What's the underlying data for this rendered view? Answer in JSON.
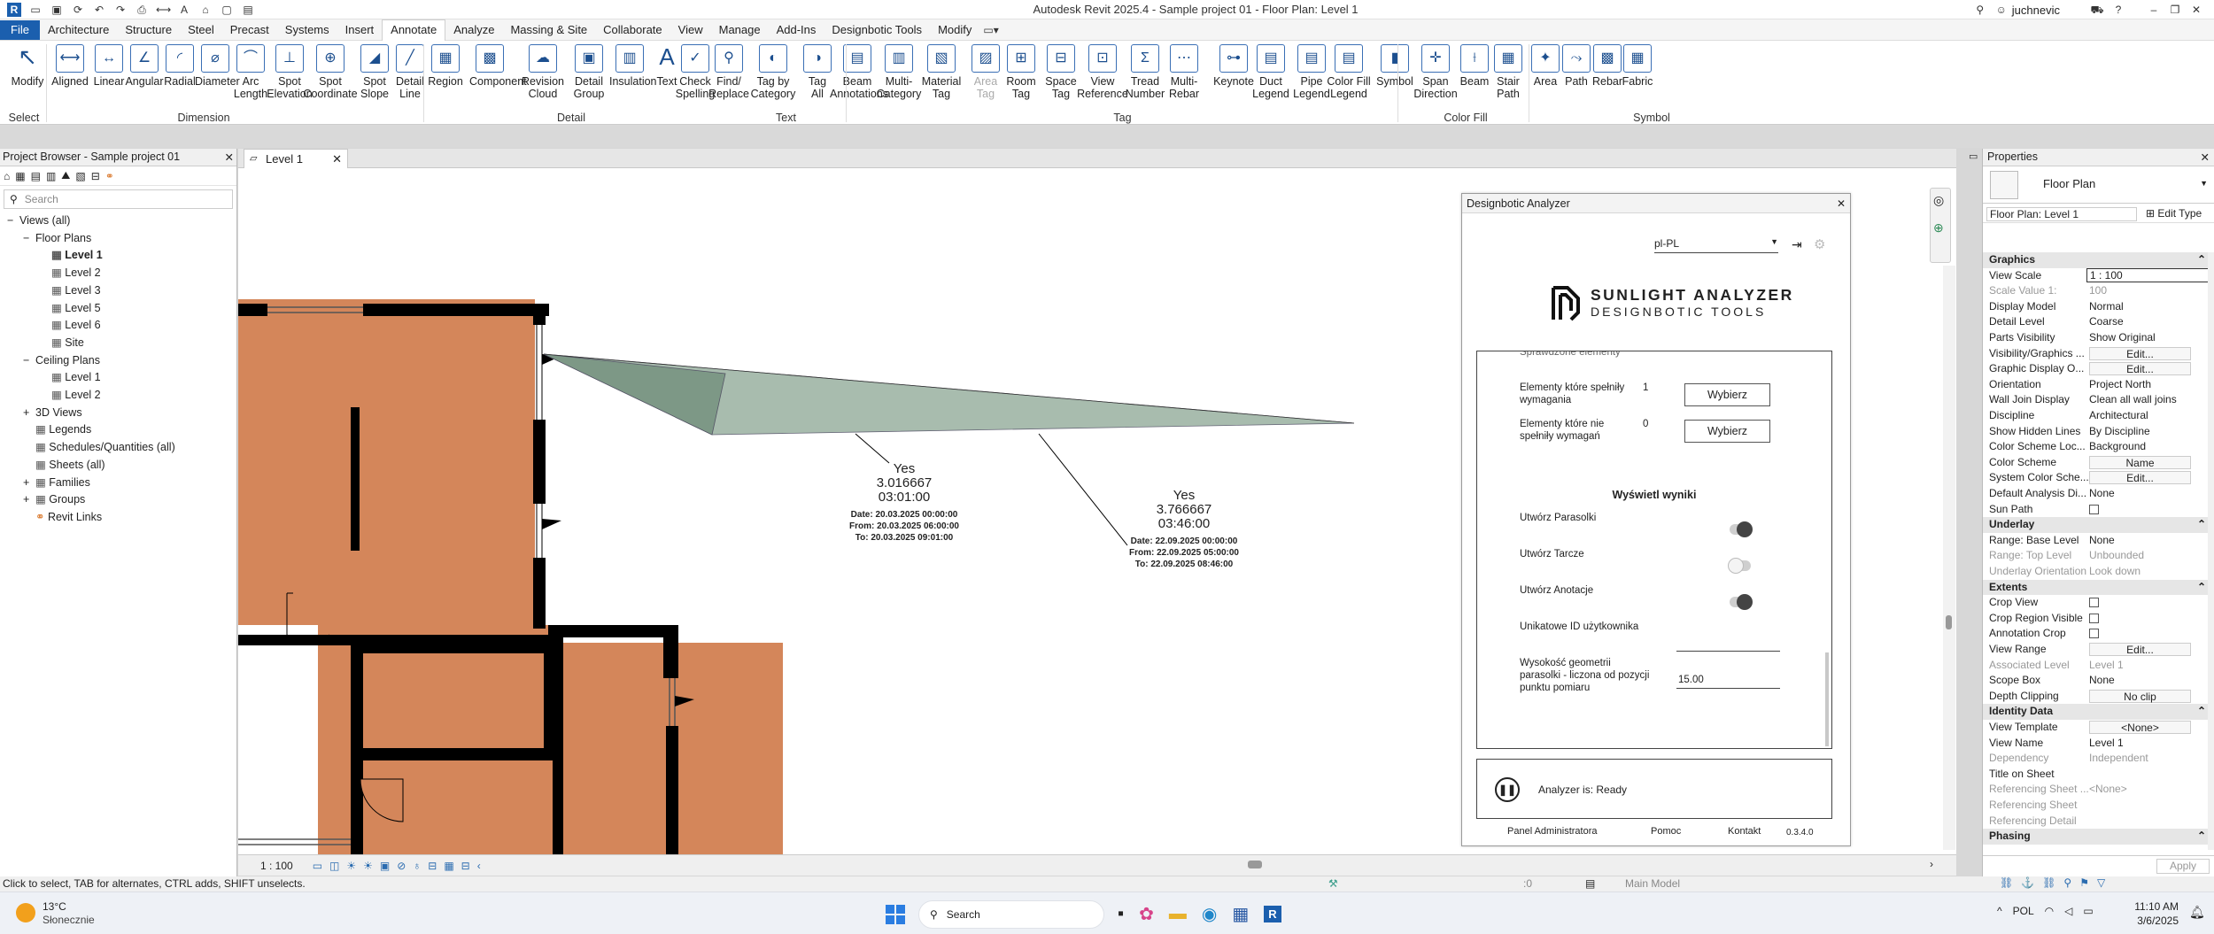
{
  "app": {
    "title": "Autodesk Revit 2025.4 - Sample project 01 - Floor Plan: Level 1",
    "user": "juchnevic"
  },
  "menu": [
    "File",
    "Architecture",
    "Structure",
    "Steel",
    "Precast",
    "Systems",
    "Insert",
    "Annotate",
    "Analyze",
    "Massing & Site",
    "Collaborate",
    "View",
    "Manage",
    "Add-Ins",
    "Designbotic Tools",
    "Modify"
  ],
  "ribbon": {
    "buttons": [
      {
        "label": "Modify"
      },
      {
        "label": "Aligned"
      },
      {
        "label": "Linear"
      },
      {
        "label": "Angular"
      },
      {
        "label": "Radial"
      },
      {
        "label": "Diameter"
      },
      {
        "label": "Arc\nLength"
      },
      {
        "label": "Spot\nElevation"
      },
      {
        "label": "Spot\nCoordinate"
      },
      {
        "label": "Spot\nSlope"
      },
      {
        "label": "Detail\nLine"
      },
      {
        "label": "Region"
      },
      {
        "label": "Component"
      },
      {
        "label": "Revision\nCloud"
      },
      {
        "label": "Detail\nGroup"
      },
      {
        "label": "Insulation"
      },
      {
        "label": "Text"
      },
      {
        "label": "Check\nSpelling"
      },
      {
        "label": "Find/\nReplace"
      },
      {
        "label": "Tag by\nCategory"
      },
      {
        "label": "Tag\nAll"
      },
      {
        "label": "Beam\nAnnotations"
      },
      {
        "label": "Multi-\nCategory"
      },
      {
        "label": "Material\nTag"
      },
      {
        "label": "Area\nTag"
      },
      {
        "label": "Room\nTag"
      },
      {
        "label": "Space\nTag"
      },
      {
        "label": "View\nReference"
      },
      {
        "label": "Tread\nNumber"
      },
      {
        "label": "Multi-\nRebar"
      },
      {
        "label": "Keynote"
      },
      {
        "label": "Duct\nLegend"
      },
      {
        "label": "Pipe\nLegend"
      },
      {
        "label": "Color Fill\nLegend"
      },
      {
        "label": "Symbol"
      },
      {
        "label": "Span\nDirection"
      },
      {
        "label": "Beam"
      },
      {
        "label": "Stair\nPath"
      },
      {
        "label": "Area"
      },
      {
        "label": "Path"
      },
      {
        "label": "Rebar"
      },
      {
        "label": "Fabric"
      }
    ],
    "groups": [
      "Select",
      "Dimension",
      "Detail",
      "Text",
      "Tag",
      "Color Fill",
      "Symbol"
    ]
  },
  "browser": {
    "title": "Project Browser - Sample project 01",
    "search_placeholder": "Search",
    "tree": [
      "Views (all)",
      "Floor Plans",
      "Level 1",
      "Level 2",
      "Level 3",
      "Level 5",
      "Level 6",
      "Site",
      "Ceiling Plans",
      "Level 1",
      "Level 2",
      "3D Views",
      "Legends",
      "Schedules/Quantities (all)",
      "Sheets (all)",
      "Families",
      "Groups",
      "Revit Links"
    ]
  },
  "view": {
    "tab": "Level 1",
    "scale": "1 : 100",
    "annotations": [
      {
        "yes": "Yes",
        "value": "3.016667",
        "time": "03:01:00",
        "date": "Date: 20.03.2025 00:00:00",
        "from": "From: 20.03.2025 06:00:00",
        "to": "To: 20.03.2025 09:01:00"
      },
      {
        "yes": "Yes",
        "value": "3.766667",
        "time": "03:46:00",
        "date": "Date: 22.09.2025 00:00:00",
        "from": "From: 22.09.2025 05:00:00",
        "to": "To: 22.09.2025 08:46:00"
      }
    ]
  },
  "analyzer": {
    "window_title": "Designbotic Analyzer",
    "language": "pl-PL",
    "logo_line1": "SUNLIGHT ANALYZER",
    "logo_line2": "DESIGNBOTIC TOOLS",
    "cut_row": "Sprawdzone elementy",
    "meeting_label": "Elementy które spełniły wymagania",
    "meeting_count": "1",
    "not_meeting_label": "Elementy które nie spełniły wymagań",
    "not_meeting_count": "0",
    "select_btn": "Wybierz",
    "results_title": "Wyświetl wyniki",
    "toggles": [
      {
        "label": "Utwórz Parasolki",
        "on": true
      },
      {
        "label": "Utwórz Tarcze",
        "on": false
      },
      {
        "label": "Utwórz Anotacje",
        "on": true
      }
    ],
    "uid_label": "Unikatowe ID użytkownika",
    "uid_value": "",
    "height_label": "Wysokość geometrii parasolki - liczona od pozycji punktu pomiaru",
    "height_value": "15.00",
    "status": "Analyzer is: Ready",
    "footer": [
      "Panel Administratora",
      "Pomoc",
      "Kontakt",
      "0.3.4.0"
    ]
  },
  "properties": {
    "title": "Properties",
    "type": "Floor Plan",
    "instance": "Floor Plan: Level 1",
    "edit_type": "Edit Type",
    "apply": "Apply",
    "rows": [
      {
        "group": "Graphics"
      },
      {
        "k": "View Scale",
        "v": "1 : 100",
        "input": true
      },
      {
        "k": "Scale Value    1:",
        "v": "100",
        "dis": true
      },
      {
        "k": "Display Model",
        "v": "Normal"
      },
      {
        "k": "Detail Level",
        "v": "Coarse"
      },
      {
        "k": "Parts Visibility",
        "v": "Show Original"
      },
      {
        "k": "Visibility/Graphics ...",
        "v": "Edit...",
        "btn": true
      },
      {
        "k": "Graphic Display O...",
        "v": "Edit...",
        "btn": true
      },
      {
        "k": "Orientation",
        "v": "Project North"
      },
      {
        "k": "Wall Join Display",
        "v": "Clean all wall joins"
      },
      {
        "k": "Discipline",
        "v": "Architectural"
      },
      {
        "k": "Show Hidden Lines",
        "v": "By Discipline"
      },
      {
        "k": "Color Scheme Loc...",
        "v": "Background"
      },
      {
        "k": "Color Scheme",
        "v": "Name",
        "btn": true
      },
      {
        "k": "System Color Sche...",
        "v": "Edit...",
        "btn": true
      },
      {
        "k": "Default Analysis Di...",
        "v": "None"
      },
      {
        "k": "Sun Path",
        "v": "",
        "cb": true
      },
      {
        "group": "Underlay"
      },
      {
        "k": "Range: Base Level",
        "v": "None"
      },
      {
        "k": "Range: Top Level",
        "v": "Unbounded",
        "dis": true
      },
      {
        "k": "Underlay Orientation",
        "v": "Look down",
        "dis": true
      },
      {
        "group": "Extents"
      },
      {
        "k": "Crop View",
        "v": "",
        "cb": true
      },
      {
        "k": "Crop Region Visible",
        "v": "",
        "cb": true
      },
      {
        "k": "Annotation Crop",
        "v": "",
        "cb": true
      },
      {
        "k": "View Range",
        "v": "Edit...",
        "btn": true
      },
      {
        "k": "Associated Level",
        "v": "Level 1",
        "dis": true
      },
      {
        "k": "Scope Box",
        "v": "None"
      },
      {
        "k": "Depth Clipping",
        "v": "No clip",
        "btn": true
      },
      {
        "group": "Identity Data"
      },
      {
        "k": "View Template",
        "v": "<None>",
        "btn": true
      },
      {
        "k": "View Name",
        "v": "Level 1"
      },
      {
        "k": "Dependency",
        "v": "Independent",
        "dis": true
      },
      {
        "k": "Title on Sheet",
        "v": ""
      },
      {
        "k": "Referencing Sheet ...",
        "v": "<None>",
        "dis": true
      },
      {
        "k": "Referencing Sheet",
        "v": "",
        "dis": true
      },
      {
        "k": "Referencing Detail",
        "v": "",
        "dis": true
      },
      {
        "group": "Phasing"
      }
    ]
  },
  "statusbar": {
    "hint": "Click to select, TAB for alternates, CTRL adds, SHIFT unselects.",
    "zero": ":0",
    "model": "Main Model"
  },
  "taskbar": {
    "temp": "13°C",
    "weather": "Słonecznie",
    "search": "Search",
    "lang": "POL",
    "time": "11:10 AM",
    "date": "3/6/2025"
  }
}
